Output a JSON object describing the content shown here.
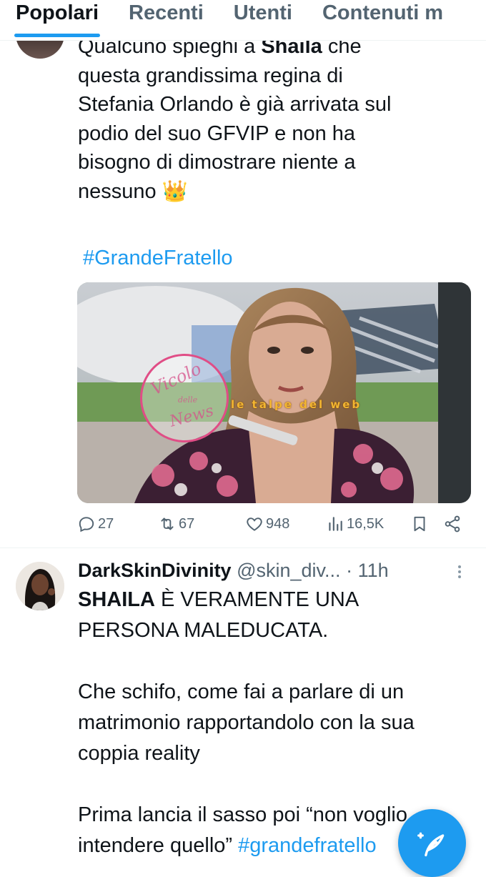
{
  "tabs": [
    {
      "label": "Popolari",
      "active": true
    },
    {
      "label": "Recenti",
      "active": false
    },
    {
      "label": "Utenti",
      "active": false
    },
    {
      "label": "Contenuti m",
      "active": false
    }
  ],
  "tweet1": {
    "lines": [
      {
        "pre": "Qualcuno spieghi a ",
        "bold": "Shaila",
        "post": " che"
      },
      {
        "text": "questa grandissima regina di"
      },
      {
        "text": "Stefania Orlando è già arrivata sul"
      },
      {
        "text": "podio del suo GFVIP e non ha"
      },
      {
        "text": "bisogno di dimostrare niente a"
      },
      {
        "text": "nessuno",
        "emoji": "👑"
      }
    ],
    "hashtag": "#GrandeFratello",
    "media": {
      "watermark_left": [
        "Vicolo",
        "delle",
        "News"
      ],
      "watermark_right": "le talpe del web"
    },
    "stats": {
      "replies": "27",
      "retweets": "67",
      "likes": "948",
      "views": "16,5K"
    }
  },
  "tweet2": {
    "name": "DarkSkinDivinity",
    "handle": "@skin_div...",
    "time": "· 11h",
    "lines": [
      {
        "bold": "SHAILA",
        "post": " È VERAMENTE UNA"
      },
      {
        "text": "PERSONA MALEDUCATA."
      },
      {
        "text": ""
      },
      {
        "text": "Che schifo, come fai a parlare di un"
      },
      {
        "text": "matrimonio rapportandolo con la sua"
      },
      {
        "text": "coppia reality"
      },
      {
        "text": ""
      },
      {
        "text": "Prima lancia il sasso poi “non voglio"
      },
      {
        "pre": "intendere quello” ",
        "hashtag": "#grandefratello"
      }
    ]
  },
  "icons": {
    "reply": "reply-icon",
    "retweet": "retweet-icon",
    "like": "heart-icon",
    "views": "views-icon",
    "bookmark": "bookmark-icon",
    "share": "share-icon",
    "compose": "compose-icon",
    "more": "more-icon"
  },
  "colors": {
    "accent": "#1d9bf0",
    "text": "#0f1419",
    "muted": "#536471"
  }
}
